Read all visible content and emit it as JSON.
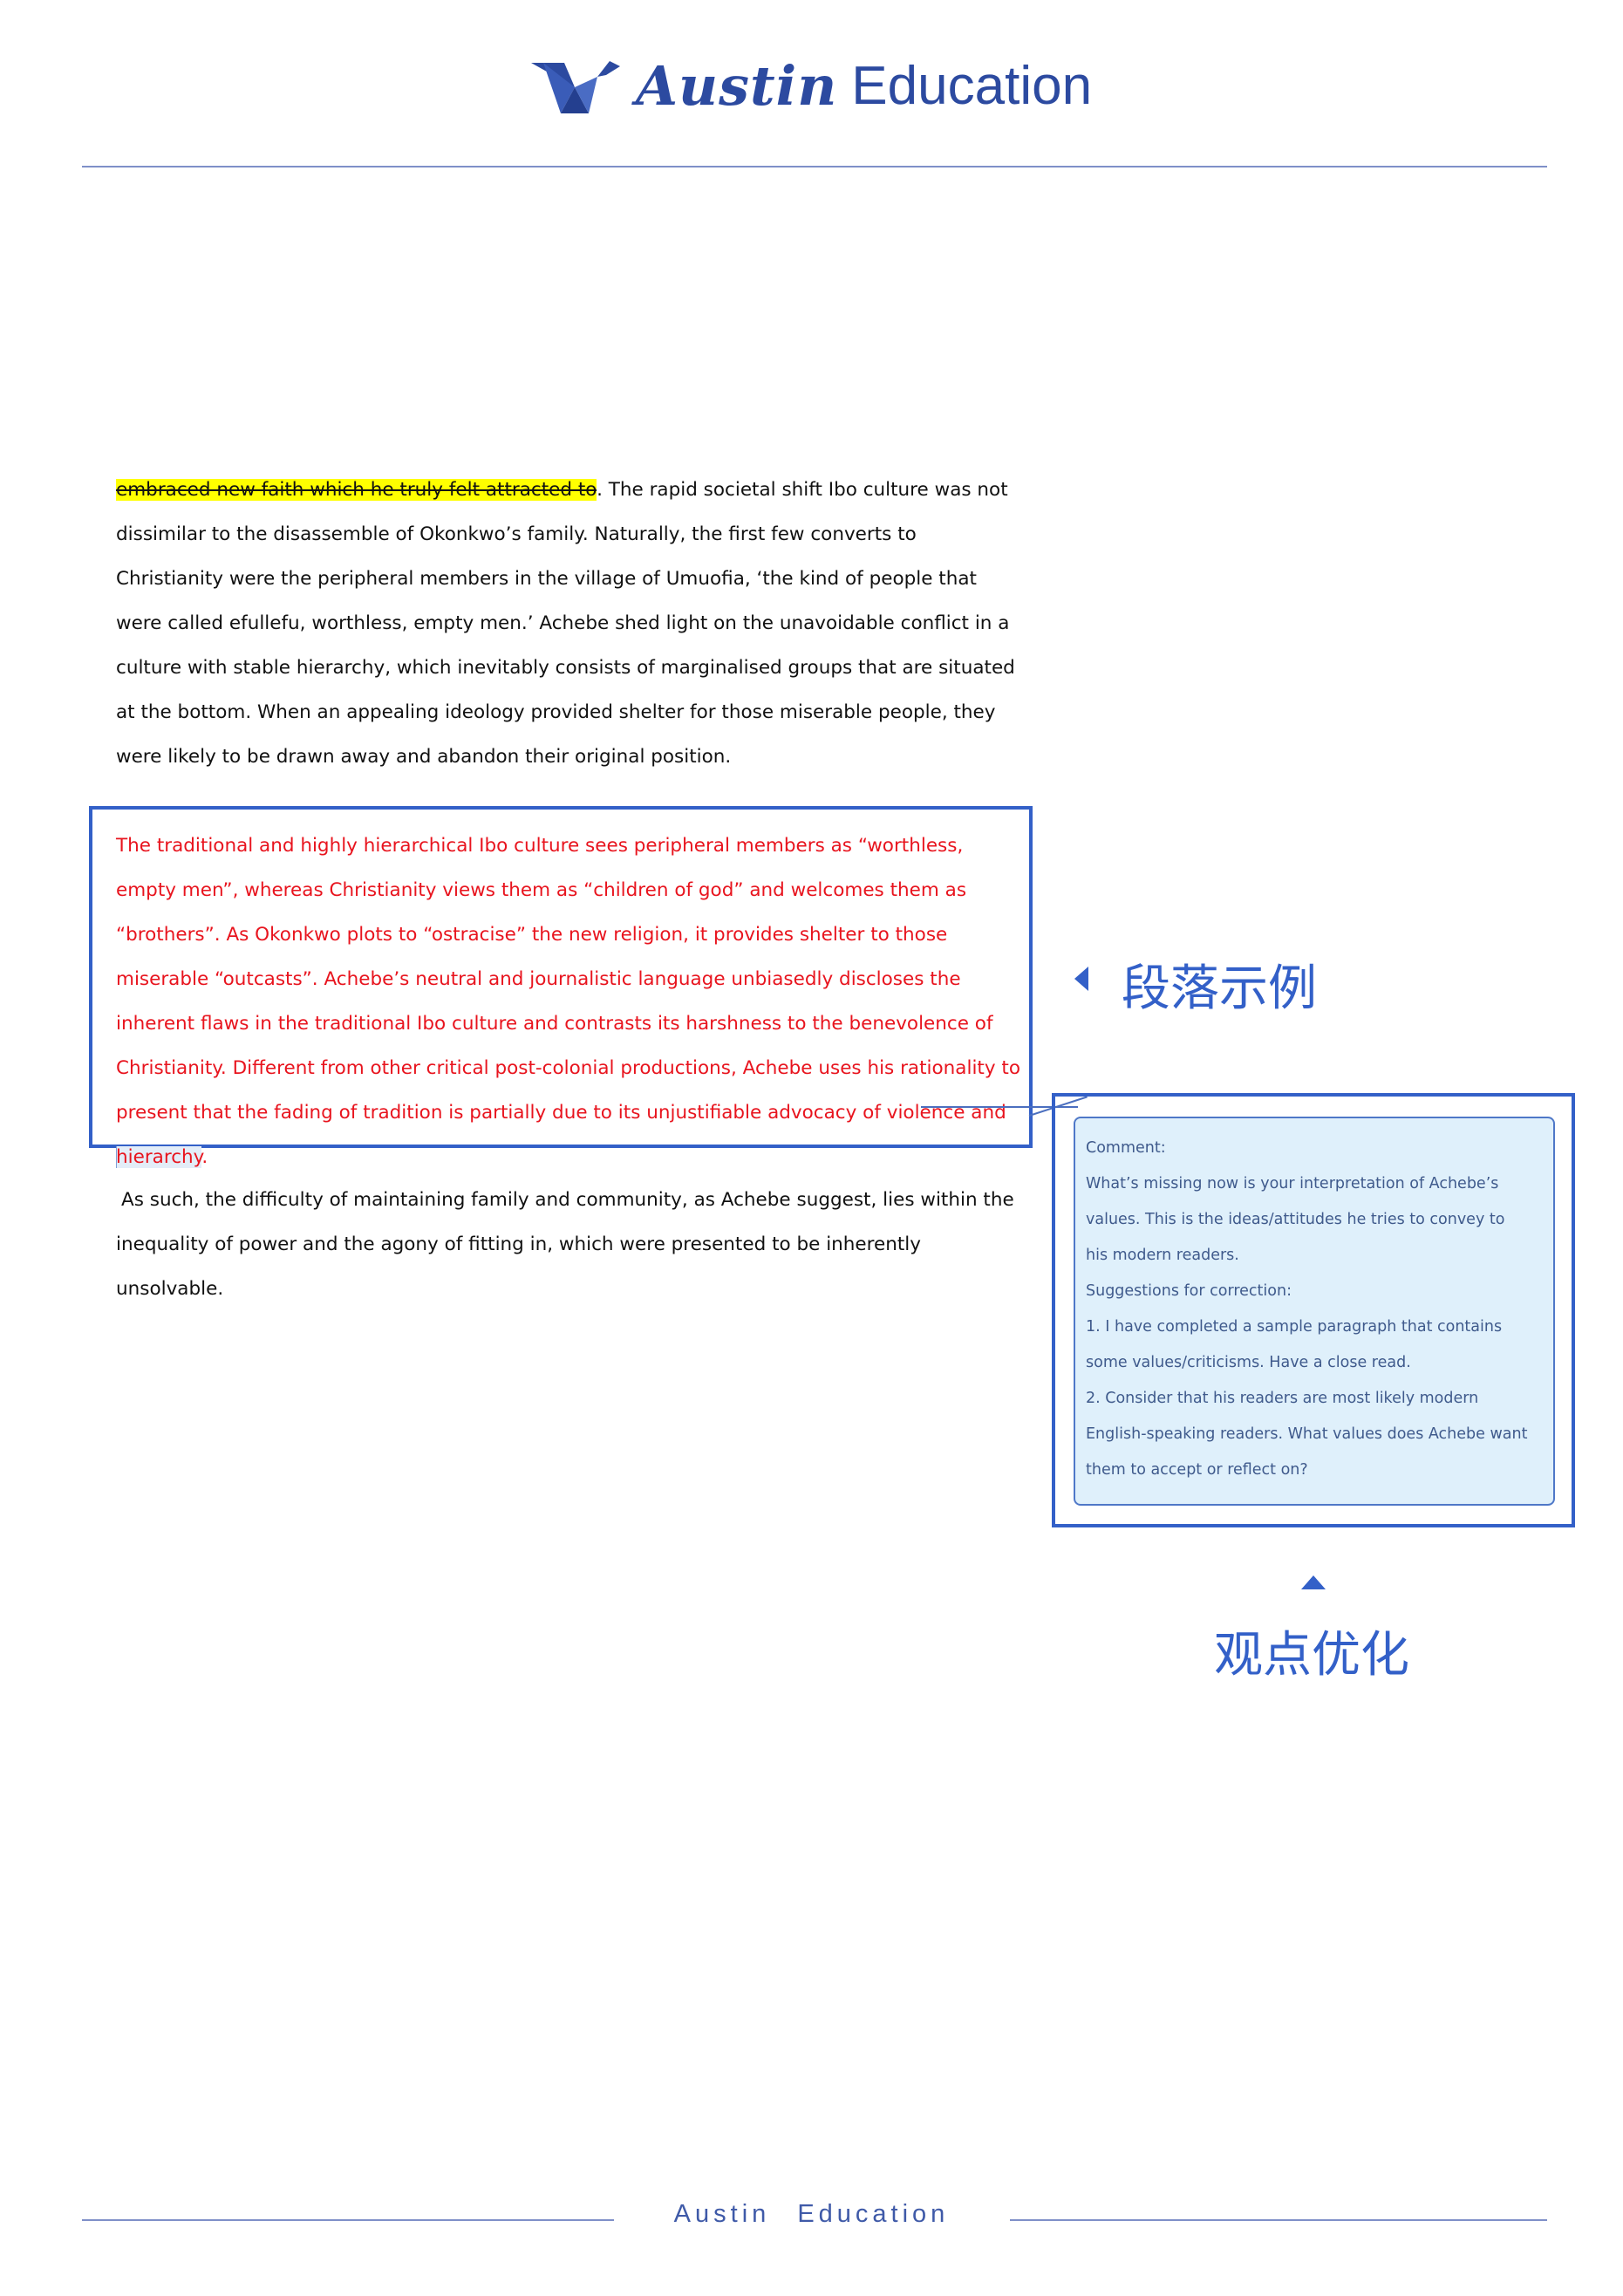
{
  "header": {
    "brand_script": "Austin",
    "brand_sans": "Education"
  },
  "essay": {
    "para1_struck": "embraced new faith which he truly felt attracted to",
    "para1_rest": ". The rapid societal shift Ibo culture was not dissimilar to the disassemble of Okonkwo’s family. Naturally, the first few converts to Christianity were the peripheral members in the village of Umuofia, ‘the kind of people that were called efullefu, worthless, empty men.’ Achebe shed light on the unavoidable conflict in a culture with stable hierarchy, which inevitably consists of marginalised groups that are situated at the bottom. When an appealing ideology provided shelter for those miserable people, they were likely to be drawn away and abandon their original position.",
    "sample_main": "The traditional and highly hierarchical Ibo culture sees peripheral members as “worthless, empty men”, whereas Christianity views them as “children of god” and welcomes them as “brothers”. As Okonkwo plots to “ostracise” the new religion, it provides shelter to those miserable “outcasts”. Achebe’s neutral and journalistic language unbiasedly discloses the inherent flaws in the traditional Ibo culture and contrasts its harshness to the benevolence of Christianity. Different from other critical post-colonial productions, Achebe uses his rationality to present that the fading of tradition is partially due to its unjustifiable advocacy of violence and ",
    "sample_highlight": "hierarchy",
    "sample_end": ".",
    "para2": "As such, the difficulty of maintaining family and community, as Achebe suggest, lies within the inequality of power and the agony of fitting in, which were presented to be inherently unsolvable."
  },
  "labels": {
    "sample_label": "段落示例",
    "optimize_label": "观点优化"
  },
  "comment": {
    "lines": [
      "Comment:",
      "What’s missing now is your interpretation of Achebe’s",
      "values. This is the ideas/attitudes he tries to convey to",
      "his modern readers.",
      "Suggestions for correction:",
      "1. I have completed a sample paragraph that contains",
      "some values/criticisms. Have a close read.",
      "2. Consider that his readers are most likely modern",
      "English-speaking readers. What values does Achebe want",
      "them to accept or reflect on?"
    ]
  },
  "footer": {
    "text": "Austin Education"
  },
  "colors": {
    "brand_blue": "#2c4aa0",
    "accent_blue": "#3360c8",
    "sample_red": "#e8141e",
    "highlight_yellow": "#ffff00",
    "comment_bg": "#dff0fb"
  }
}
